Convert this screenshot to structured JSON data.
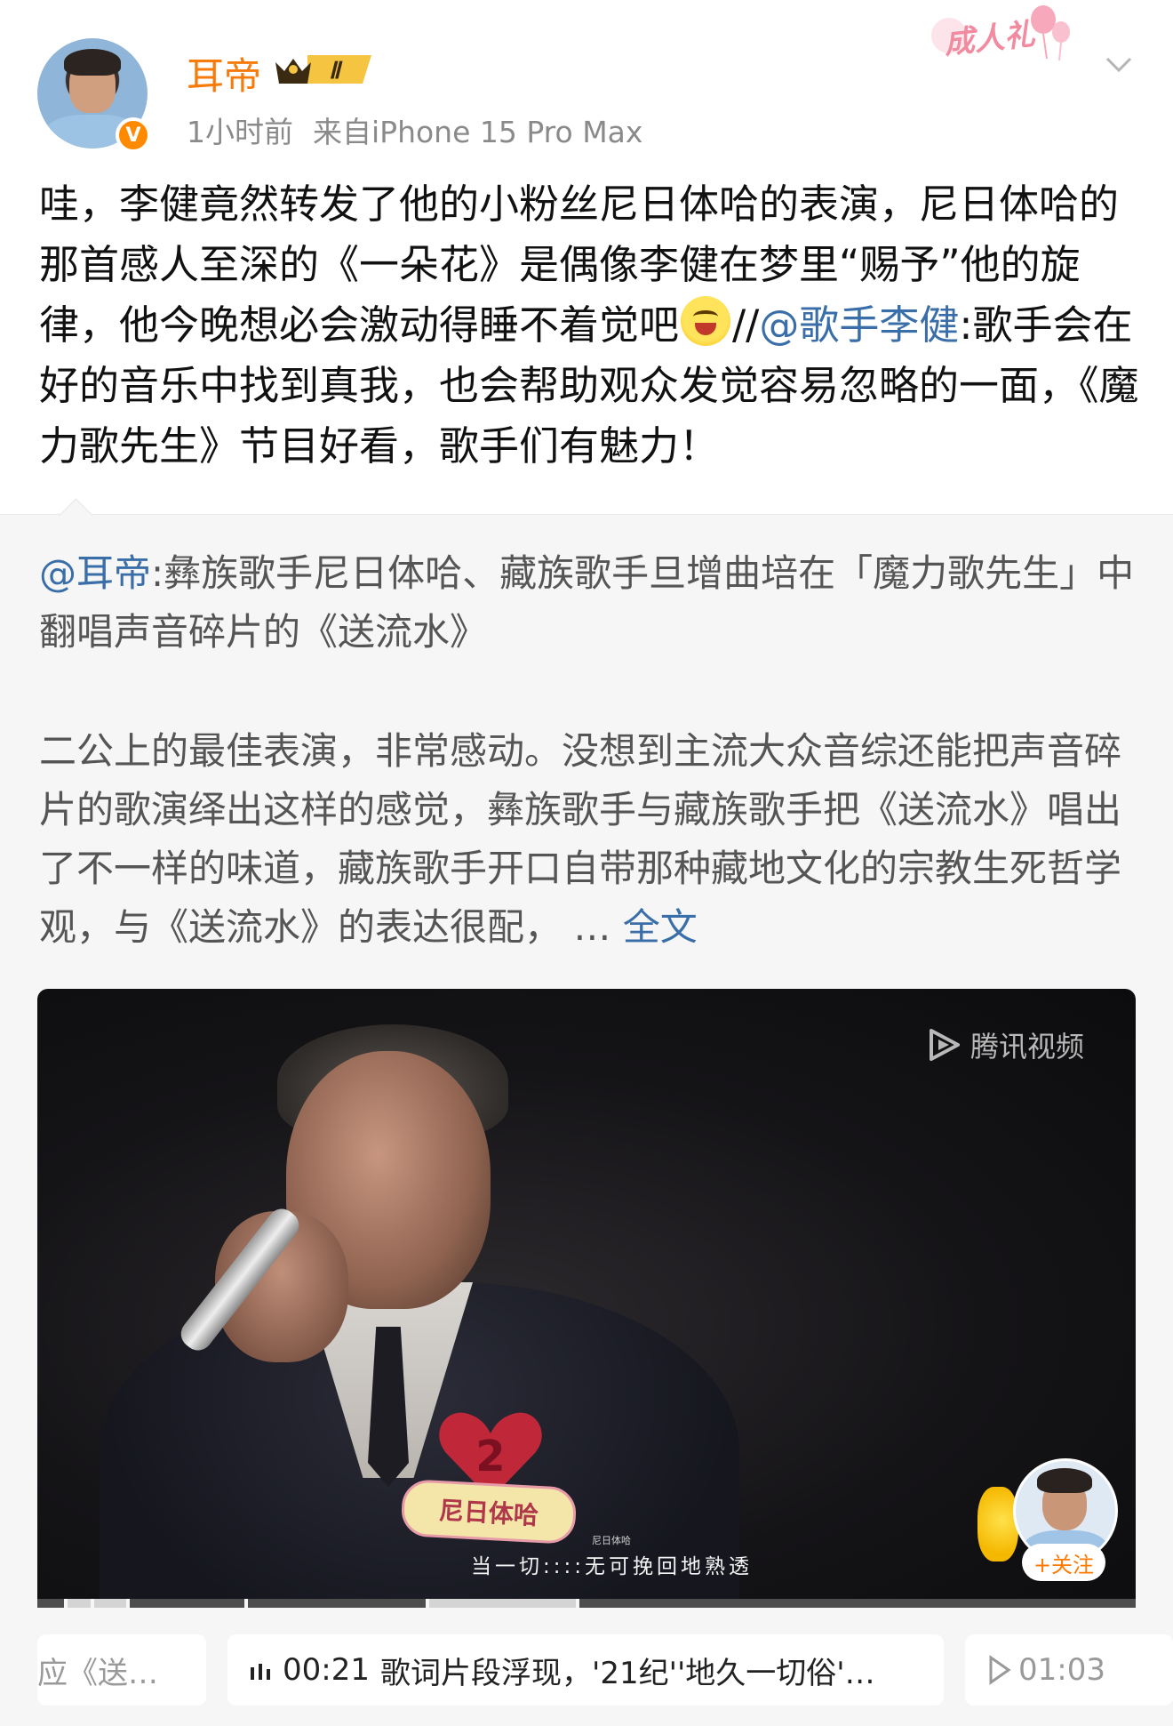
{
  "post": {
    "username": "耳帝",
    "vip_level": "Ⅱ",
    "time": "1小时前",
    "source": "来自iPhone 15 Pro Max",
    "badge": "成人礼",
    "text_part1": "哇，李健竟然转发了他的小粉丝尼日体哈的表演，尼日体哈的那首感人至深的《一朵花》是偶像李健在梦里“赐予”他的旋律，他今晚想必会激动得睡不着觉吧",
    "text_sep": "//",
    "mention": "@歌手李健",
    "text_part2": ":歌手会在好的音乐中找到真我，也会帮助观众发觉容易忽略的一面，《魔力歌先生》节目好看，歌手们有魅力！"
  },
  "retweet": {
    "mention": "@耳帝",
    "head_text": ":彝族歌手尼日体哈、藏族歌手旦增曲培在「魔力歌先生」中翻唱声音碎片的《送流水》",
    "body_text": "二公上的最佳表演，非常感动。没想到主流大众音综还能把声音碎片的歌演绎出这样的感觉，彝族歌手与藏族歌手把《送流水》唱出了不一样的味道，藏族歌手开口自带那种藏地文化的宗教生死哲学观，与《送流水》的表达很配，",
    "ellipsis": " … ",
    "full_text_link": "全文"
  },
  "video": {
    "watermark": "腾讯视频",
    "nameplate": "尼日体哈",
    "heart_number": "2",
    "lyric_small": "尼日体哈",
    "lyric": "当一切::::无可挽回地熟透",
    "follow_label": "+关注"
  },
  "chips": {
    "left": "应《送…",
    "mid_time": "00:21",
    "mid_text": "歌词片段浮现，'21纪''地久一切俗'…",
    "right": "01:03"
  },
  "colors": {
    "username": "#f77b0b",
    "link": "#3a6ea8",
    "retweet_bg": "#f6f6f6"
  }
}
